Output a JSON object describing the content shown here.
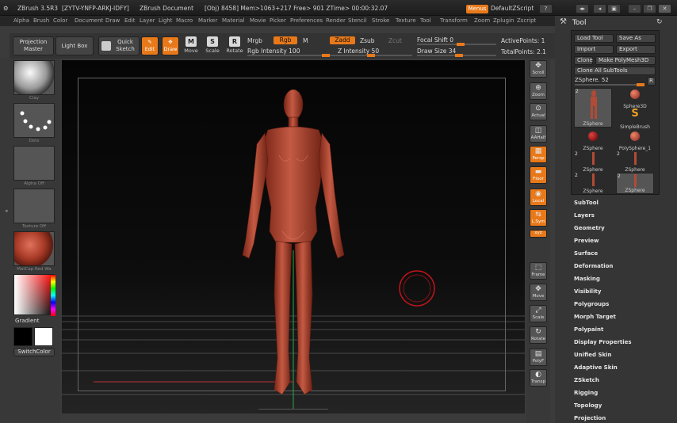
{
  "titlebar": {
    "app": "ZBrush 3.5R3",
    "code": "[ZYTV-YNFP-ARKJ-IDFY]",
    "doc": "ZBrush Document",
    "stats": "[Obj) 8458]  Mem>1063+217  Free> 901  ZTime> 00:00:32.07",
    "menus": "Menus",
    "script": "DefaultZScript"
  },
  "menubar": [
    "Alpha",
    "Brush",
    "Color",
    "Document",
    "Draw",
    "Edit",
    "Layer",
    "Light",
    "Macro",
    "Marker",
    "Material",
    "Movie",
    "Picker",
    "Preferences",
    "Render",
    "Stencil",
    "Stroke",
    "Texture",
    "Tool",
    "Transform",
    "Zoom",
    "Zplugin",
    "Zscript"
  ],
  "toolbar": {
    "projection_master": "Projection Master",
    "light_box": "Light Box",
    "quick_sketch": "Quick Sketch",
    "edit": "Edit",
    "draw": "Draw",
    "move": "Move",
    "scale": "Scale",
    "rotate": "Rotate",
    "mrgb": "Mrgb",
    "rgb": "Rgb",
    "m": "M",
    "rgb_intensity": "Rgb Intensity 100",
    "zadd": "Zadd",
    "zsub": "Zsub",
    "zcut": "Zcut",
    "z_intensity": "Z Intensity 50",
    "focal_shift": "Focal Shift 0",
    "draw_size": "Draw Size 34",
    "active_points": "ActivePoints: 1",
    "total_points": "TotalPoints: 2.1",
    "rgb_intensity_pct": 100,
    "z_intensity_pct": 50,
    "focal_shift_val": 0,
    "draw_size_val": 34
  },
  "leftshelf": {
    "clay": "Clay",
    "dots": "Dots",
    "alpha": "Alpha Off",
    "texture": "Texture Off",
    "matcap": "MatCap Red Wa",
    "gradient": "Gradient",
    "switch_color": "SwitchColor"
  },
  "rightshelf": [
    "Scroll",
    "Zoom",
    "Actual",
    "AAHalf",
    "Persp",
    "Floor",
    "Local",
    "L.Sym",
    "xyz",
    "Frame",
    "Move",
    "Scale",
    "Rotate",
    "PolyF",
    "Transp"
  ],
  "rightpanel": {
    "title": "Tool",
    "load_tool": "Load Tool",
    "save_as": "Save As",
    "import": "Import",
    "export": "Export",
    "clone": "Clone",
    "make_polymesh": "Make PolyMesh3D",
    "clone_all": "Clone All SubTools",
    "zsphere": "ZSphere. 52",
    "r": "R",
    "thumbs": [
      {
        "num": "2",
        "name": "ZSphere"
      },
      {
        "num": "",
        "name": "Sphere3D"
      },
      {
        "num": "",
        "name": "SimpleBrush"
      },
      {
        "num": "",
        "name": "ZSphere"
      },
      {
        "num": "",
        "name": "PolySphere_1"
      },
      {
        "num": "2",
        "name": "ZSphere"
      },
      {
        "num": "2",
        "name": "ZSphere"
      },
      {
        "num": "2",
        "name": "ZSphere"
      },
      {
        "num": "2",
        "name": "ZSphere"
      }
    ],
    "sections": [
      "SubTool",
      "Layers",
      "Geometry",
      "Preview",
      "Surface",
      "Deformation",
      "Masking",
      "Visibility",
      "Polygroups",
      "Morph Target",
      "Polypaint",
      "Display Properties",
      "Unified Skin",
      "Adaptive Skin",
      "ZSketch",
      "Rigging",
      "Topology",
      "Projection"
    ]
  },
  "colors": {
    "accent": "#e8791a",
    "model": "#b34a35"
  }
}
